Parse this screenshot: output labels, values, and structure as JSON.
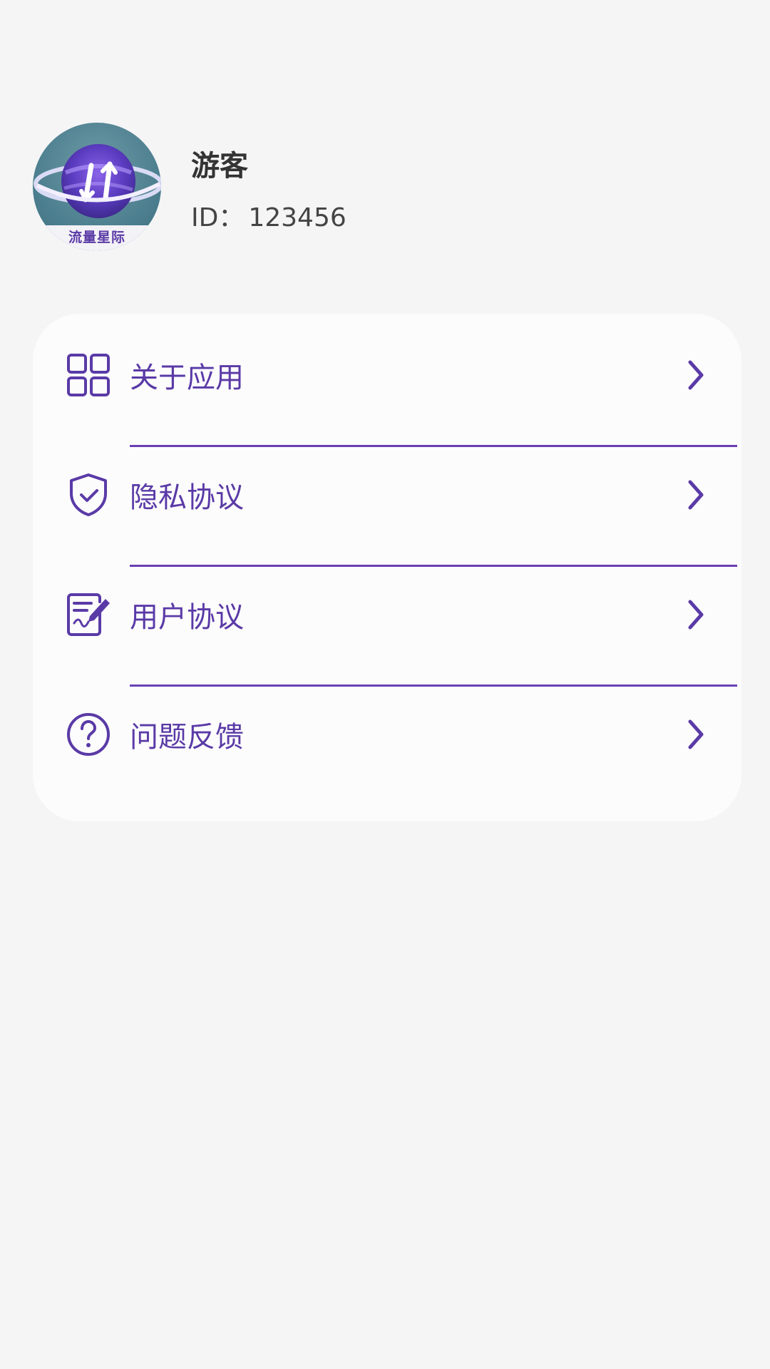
{
  "profile": {
    "avatar_brand_text": "流量星际",
    "name": "游客",
    "id_label": "ID：",
    "id_value": "123456"
  },
  "menu": {
    "items": [
      {
        "label": "关于应用",
        "icon": "grid-icon"
      },
      {
        "label": "隐私协议",
        "icon": "shield-check-icon"
      },
      {
        "label": "用户协议",
        "icon": "document-edit-icon"
      },
      {
        "label": "问题反馈",
        "icon": "question-circle-icon"
      }
    ]
  },
  "colors": {
    "accent": "#5a3aa6",
    "background": "#f5f5f6",
    "card": "#fcfcfd",
    "text_primary": "#333333"
  }
}
